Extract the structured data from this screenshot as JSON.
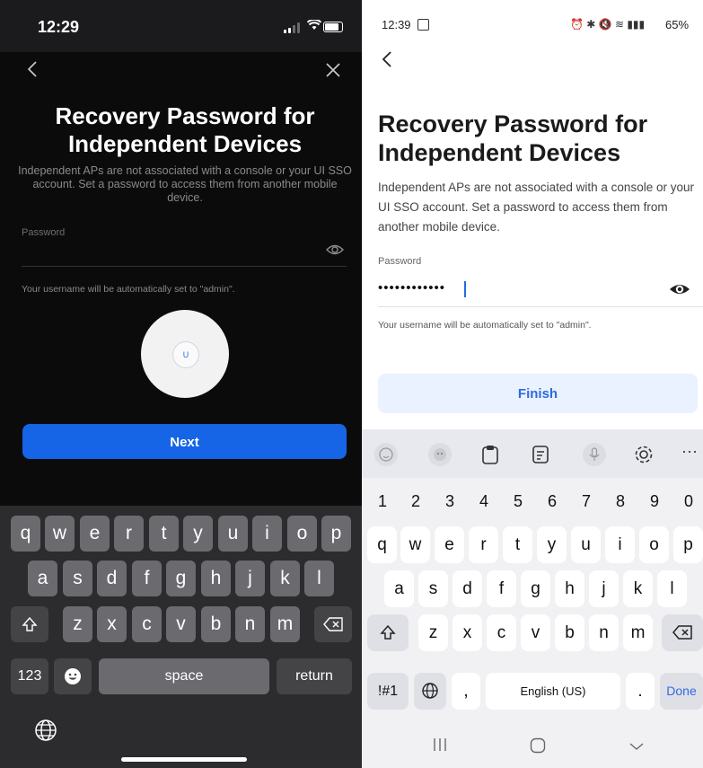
{
  "ios": {
    "status_time": "12:29",
    "title": "Recovery Password for Independent Devices",
    "description": "Independent APs are not associated with a console or your UI SSO account. Set a password to access them from another mobile device.",
    "password_label": "Password",
    "username_hint": "Your username will be automatically set to \"admin\".",
    "device_logo": "U",
    "next_label": "Next",
    "keyboard": {
      "row1": [
        "q",
        "w",
        "e",
        "r",
        "t",
        "y",
        "u",
        "i",
        "o",
        "p"
      ],
      "row2": [
        "a",
        "s",
        "d",
        "f",
        "g",
        "h",
        "j",
        "k",
        "l"
      ],
      "row3": [
        "z",
        "x",
        "c",
        "v",
        "b",
        "n",
        "m"
      ],
      "numbers_key": "123",
      "space_key": "space",
      "return_key": "return"
    },
    "icons": [
      "back-chevron-icon",
      "close-icon",
      "eye-icon",
      "shift-icon",
      "backspace-icon",
      "emoji-icon",
      "globe-icon",
      "wifi-icon",
      "battery-icon"
    ],
    "colors": {
      "background": "#0b0b0c",
      "accent": "#1565e6"
    }
  },
  "android": {
    "status_time": "12:39",
    "status_icons": "⏰ ✱ 🔇 ≋ ▮▮▮",
    "battery": "65%",
    "title": "Recovery Password for Independent Devices",
    "description": "Independent APs are not associated with a console or your UI SSO account. Set a password to access them from another mobile device.",
    "password_label": "Password",
    "password_value": "••••••••••••",
    "username_hint": "Your username will be automatically set to \"admin\".",
    "finish_label": "Finish",
    "keyboard": {
      "numbers": [
        "1",
        "2",
        "3",
        "4",
        "5",
        "6",
        "7",
        "8",
        "9",
        "0"
      ],
      "row1": [
        "q",
        "w",
        "e",
        "r",
        "t",
        "y",
        "u",
        "i",
        "o",
        "p"
      ],
      "row2": [
        "a",
        "s",
        "d",
        "f",
        "g",
        "h",
        "j",
        "k",
        "l"
      ],
      "row3": [
        "z",
        "x",
        "c",
        "v",
        "b",
        "n",
        "m"
      ],
      "symbols_key": "!#1",
      "comma_key": ",",
      "space_key": "English (US)",
      "period_key": ".",
      "done_key": "Done",
      "toolbar_more": "···"
    },
    "icons": [
      "back-arrow-icon",
      "eye-icon",
      "emoji-icon",
      "sticker-icon",
      "clipboard-icon",
      "text-mode-icon",
      "mic-icon",
      "settings-icon",
      "shift-icon",
      "backspace-icon",
      "globe-icon",
      "recent-apps-icon",
      "home-icon",
      "nav-back-icon"
    ],
    "colors": {
      "accent": "#2d6be0",
      "finish_bg": "#eaf2ff"
    }
  }
}
